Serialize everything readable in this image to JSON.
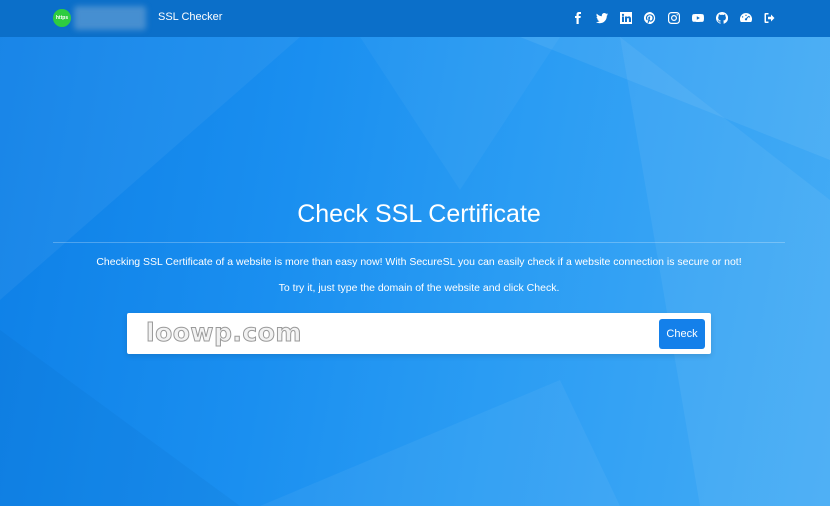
{
  "header": {
    "logo_text": "https",
    "title": "SSL Checker",
    "social_icons": [
      "facebook-icon",
      "twitter-icon",
      "linkedin-icon",
      "pinterest-icon",
      "instagram-icon",
      "youtube-icon",
      "github-icon",
      "dashboard-icon",
      "logout-icon"
    ]
  },
  "main": {
    "title": "Check SSL Certificate",
    "description": "Checking SSL Certificate of a website is more than easy now! With SecureSL you can easily check if a website connection is secure or not!",
    "instruction": "To try it, just type the domain of the website and click Check.",
    "search": {
      "value": "",
      "placeholder": ""
    },
    "check_label": "Check",
    "watermark": "loowp.com"
  },
  "colors": {
    "navbar": "#0b6fc9",
    "hero_start": "#0d7fe6",
    "hero_end": "#45acf5",
    "button": "#1480ea",
    "logo": "#2ecc40"
  }
}
